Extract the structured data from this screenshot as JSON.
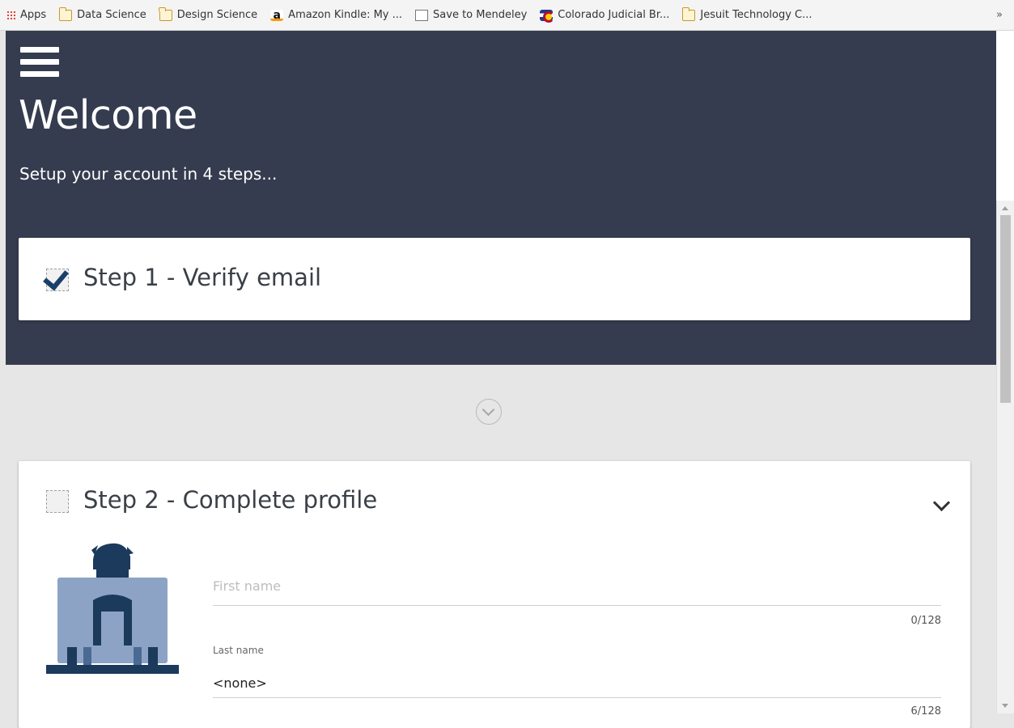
{
  "bookmarks": [
    {
      "label": "Apps",
      "icon": "apps-grid-icon"
    },
    {
      "label": "Data Science",
      "icon": "folder-icon"
    },
    {
      "label": "Design Science",
      "icon": "folder-icon"
    },
    {
      "label": "Amazon Kindle: My ...",
      "icon": "amazon-icon"
    },
    {
      "label": "Save to Mendeley",
      "icon": "page-icon"
    },
    {
      "label": "Colorado Judicial Br...",
      "icon": "colorado-flag-icon"
    },
    {
      "label": "Jesuit Technology C...",
      "icon": "folder-icon"
    }
  ],
  "bookmarks_more": "»",
  "header": {
    "title": "Welcome",
    "subtitle": "Setup your account in 4 steps..."
  },
  "steps": [
    {
      "label": "Step 1 - Verify email",
      "checked": true
    },
    {
      "label": "Step 2 - Complete profile",
      "checked": false
    }
  ],
  "profile_form": {
    "first_name_placeholder": "First name",
    "first_name_counter": "0/128",
    "last_name_label": "Last name",
    "last_name_value": "<none>",
    "last_name_counter": "6/128"
  },
  "colors": {
    "header_bg": "#353c4f",
    "page_bg": "#e6e6e6",
    "check_color": "#1a3f6a",
    "avatar_blue": "#8da3c5",
    "avatar_dark": "#1b3a5c"
  }
}
